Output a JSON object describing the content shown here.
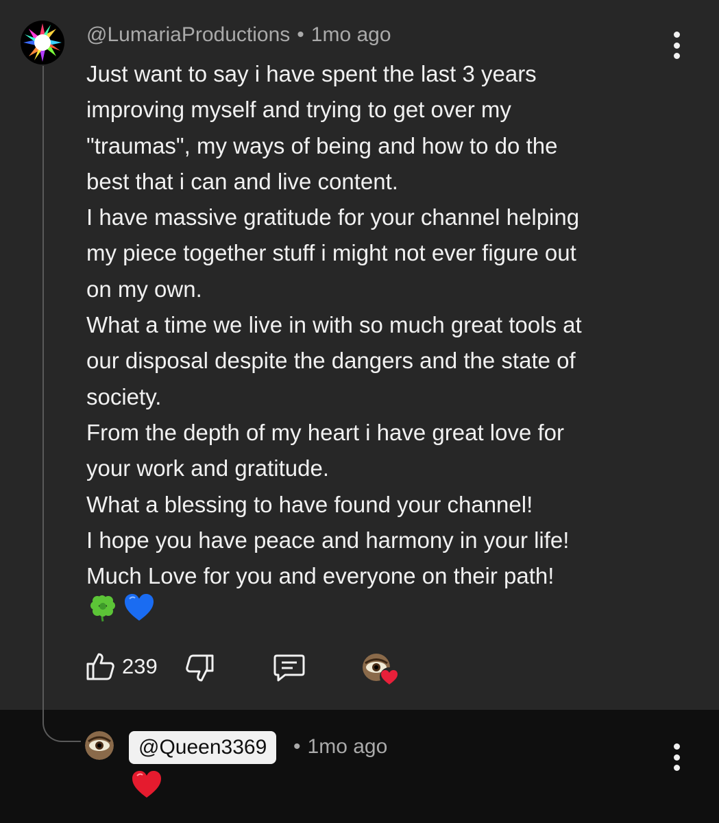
{
  "comment": {
    "author": "@LumariaProductions",
    "separator": "•",
    "time": "1mo ago",
    "body_lines": [
      "Just want to say i have spent the last 3 years",
      "improving myself and trying to get over my",
      "\"traumas\", my ways of being and how to do the",
      "best that i can and live content.",
      "I have massive gratitude for your channel helping",
      "my piece together stuff i might not ever figure out",
      "on my own.",
      "What a time we live in with so much great tools at",
      "our disposal despite the dangers and the state of",
      "society.",
      "From the depth of my heart i have great love for",
      "your work and gratitude.",
      "What a blessing to have found your channel!",
      "I hope you have peace and harmony in your life!",
      "Much Love for you and everyone on their path!"
    ],
    "emoji": [
      "four-leaf-clover",
      "blue-heart"
    ],
    "like_count": "239",
    "icons": {
      "like": "thumbs-up-icon",
      "dislike": "thumbs-down-icon",
      "reply": "reply-comment-icon",
      "creator_heart": "creator-heart-badge",
      "menu": "more-vertical-icon"
    }
  },
  "reply": {
    "author": "@Queen3369",
    "separator": "•",
    "time": "1mo ago",
    "emoji": [
      "red-heart"
    ]
  },
  "colors": {
    "comment_bg": "#272727",
    "reply_bg": "#0f0f0f",
    "primary_text": "#f1f1f1",
    "secondary_text": "#aaaaaa",
    "thread_line": "#5a5a5a"
  }
}
